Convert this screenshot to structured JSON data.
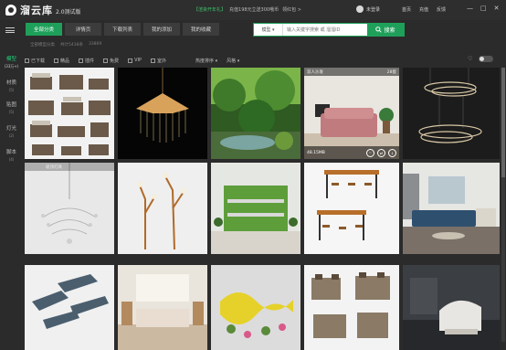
{
  "app": {
    "name": "溜云库",
    "version": "2.0测试版",
    "promo": {
      "tag": "【渲染开年礼】",
      "text": "充值198元立送300哦币",
      "link": "领红包 >"
    },
    "user": "未登录",
    "nav": [
      "首页",
      "充值",
      "反馈"
    ],
    "window_controls": [
      "—",
      "□",
      "✕"
    ]
  },
  "tabs": [
    {
      "label": "全部分类",
      "active": true
    },
    {
      "label": "详情页",
      "active": false
    },
    {
      "label": "下载列表",
      "active": false
    },
    {
      "label": "我的添加",
      "active": false
    },
    {
      "label": "我的收藏",
      "active": false
    }
  ],
  "search": {
    "scope": "模型",
    "placeholder": "输入关键字搜索 或 溜溜ID",
    "button": "搜索"
  },
  "breadcrumb": [
    "全部模型分类",
    "共计5438条",
    "33869"
  ],
  "sidebar": [
    {
      "label": "模型",
      "count": "(33万+)",
      "active": true
    },
    {
      "label": "材质",
      "count": "(5)",
      "active": false
    },
    {
      "label": "贴图",
      "count": "(5)",
      "active": false
    },
    {
      "label": "灯光",
      "count": "(2)",
      "active": false
    },
    {
      "label": "脚本",
      "count": "(4)",
      "active": false
    }
  ],
  "filters": {
    "checks": [
      "已下载",
      "精品",
      "插件",
      "免费",
      "VIP",
      "室外"
    ],
    "sorts": [
      "热度排序",
      "风格"
    ]
  },
  "cards": {
    "sofa_title": "双人沙发",
    "sofa_size": "48.15MB",
    "sofa_count": "28套",
    "chandelier_label": "吸顶灯具"
  },
  "colors": {
    "accent": "#1fa05a",
    "background": "#2b2b2b"
  }
}
